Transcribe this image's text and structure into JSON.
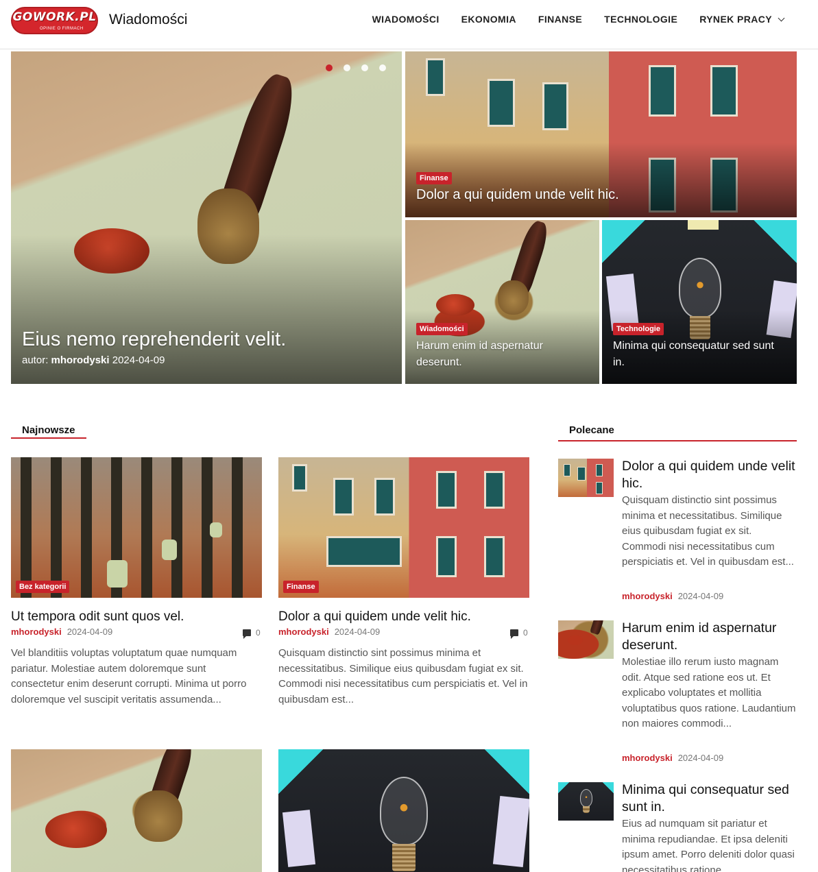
{
  "header": {
    "logo_text": "GOWORK.PL",
    "logo_subtext": "OPINIE O FIRMACH",
    "site_title": "Wiadomości",
    "nav": [
      {
        "label": "WIADOMOŚCI"
      },
      {
        "label": "EKONOMIA"
      },
      {
        "label": "FINANSE"
      },
      {
        "label": "TECHNOLOGIE"
      },
      {
        "label": "RYNEK PRACY",
        "dropdown": true
      }
    ]
  },
  "hero": {
    "main": {
      "title": "Eius nemo reprehenderit velit.",
      "author_prefix": "autor:",
      "author": "mhorodyski",
      "date": "2024-04-09",
      "slides": 4,
      "active_slide": 1
    },
    "top_right": {
      "category": "Finanse",
      "title": "Dolor a qui quidem unde velit hic."
    },
    "bottom_left": {
      "category": "Wiadomości",
      "title": "Harum enim id aspernatur deserunt."
    },
    "bottom_right": {
      "category": "Technologie",
      "title": "Minima qui consequatur sed sunt in."
    }
  },
  "latest": {
    "heading": "Najnowsze",
    "articles": [
      {
        "category": "Bez kategorii",
        "title": "Ut tempora odit sunt quos vel.",
        "author": "mhorodyski",
        "date": "2024-04-09",
        "comments": "0",
        "excerpt": "Vel blanditiis voluptas voluptatum quae numquam pariatur. Molestiae autem doloremque sunt consectetur enim deserunt corrupti. Minima ut porro doloremque vel suscipit veritatis assumenda..."
      },
      {
        "category": "Finanse",
        "title": "Dolor a qui quidem unde velit hic.",
        "author": "mhorodyski",
        "date": "2024-04-09",
        "comments": "0",
        "excerpt": "Quisquam distinctio sint possimus minima et necessitatibus. Similique eius quibusdam fugiat ex sit. Commodi nisi necessitatibus cum perspiciatis et. Vel in quibusdam est..."
      }
    ]
  },
  "featured": {
    "heading": "Polecane",
    "items": [
      {
        "title": "Dolor a qui quidem unde velit hic.",
        "excerpt": "Quisquam distinctio sint possimus minima et necessitatibus. Similique eius quibusdam fugiat ex sit. Commodi nisi necessitatibus cum perspiciatis et. Vel in quibusdam est...",
        "author": "mhorodyski",
        "date": "2024-04-09"
      },
      {
        "title": "Harum enim id aspernatur deserunt.",
        "excerpt": "Molestiae illo rerum iusto magnam odit. Atque sed ratione eos ut. Et explicabo voluptates et mollitia voluptatibus quos ratione. Laudantium non maiores commodi...",
        "author": "mhorodyski",
        "date": "2024-04-09"
      },
      {
        "title": "Minima qui consequatur sed sunt in.",
        "excerpt": "Eius ad numquam sit pariatur et minima repudiandae. Et ipsa deleniti ipsum amet. Porro deleniti dolor quasi necessitatibus ratione"
      }
    ]
  },
  "colors": {
    "accent": "#c8232b",
    "text": "#111111",
    "muted": "#777777"
  }
}
